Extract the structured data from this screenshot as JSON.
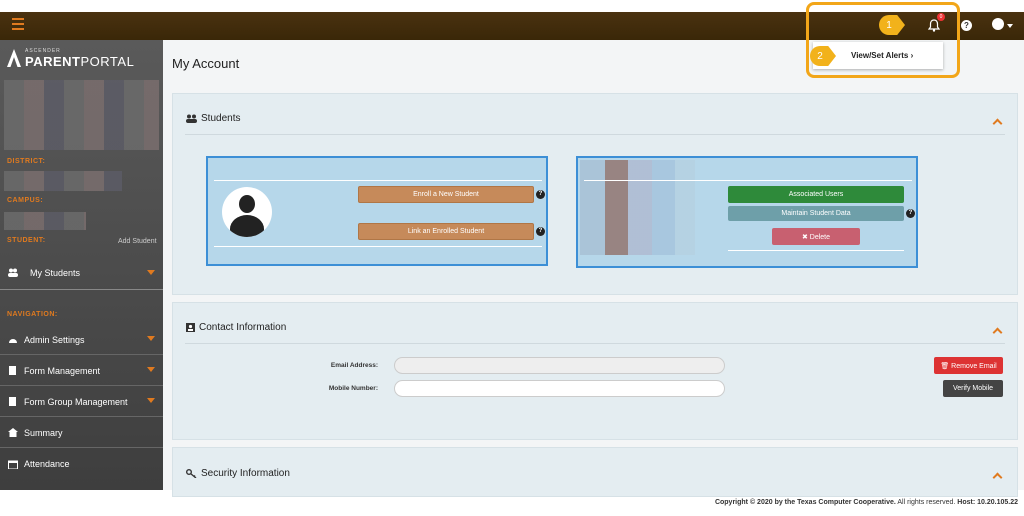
{
  "header": {
    "menu_icon": "hamburger-icon",
    "notification_count": "0",
    "help_label": "?"
  },
  "dropdown": {
    "view_alerts_label": "View/Set Alerts ›"
  },
  "callouts": [
    "1",
    "2"
  ],
  "logo": {
    "small": "ASCENDER",
    "bold": "PARENT",
    "thin": "PORTAL"
  },
  "sidebar": {
    "district_label": "DISTRICT:",
    "campus_label": "CAMPUS:",
    "student_label": "STUDENT:",
    "add_student": "Add Student",
    "my_students": "My Students",
    "navigation_label": "NAVIGATION:",
    "items": [
      {
        "label": "Admin Settings",
        "icon": "dashboard-icon"
      },
      {
        "label": "Form Management",
        "icon": "book-icon"
      },
      {
        "label": "Form Group Management",
        "icon": "book-icon"
      },
      {
        "label": "Summary",
        "icon": "home-icon"
      },
      {
        "label": "Attendance",
        "icon": "calendar-icon"
      }
    ]
  },
  "main": {
    "page_title": "My Account",
    "students_panel": {
      "title": "Students",
      "enroll_new": "Enroll a New Student",
      "link_enrolled": "Link an Enrolled Student",
      "associated_users": "Associated Users",
      "maintain_data": "Maintain Student Data",
      "delete": "✖ Delete",
      "help": "?"
    },
    "contact_panel": {
      "title": "Contact Information",
      "email_label": "Email Address:",
      "email_value": "",
      "mobile_label": "Mobile Number:",
      "mobile_value": "",
      "remove_email": "🗑 Remove Email",
      "verify_mobile": "Verify Mobile"
    },
    "security_panel": {
      "title": "Security Information"
    }
  },
  "footer": {
    "copyright": "Copyright © 2020 by the Texas Computer Cooperative.",
    "rights": " All rights reserved.",
    "host": " Host: 10.20.105.22"
  },
  "colors": {
    "accent": "#e07a1f",
    "callout": "#f2b21b",
    "card_border": "#3c8fd6"
  }
}
